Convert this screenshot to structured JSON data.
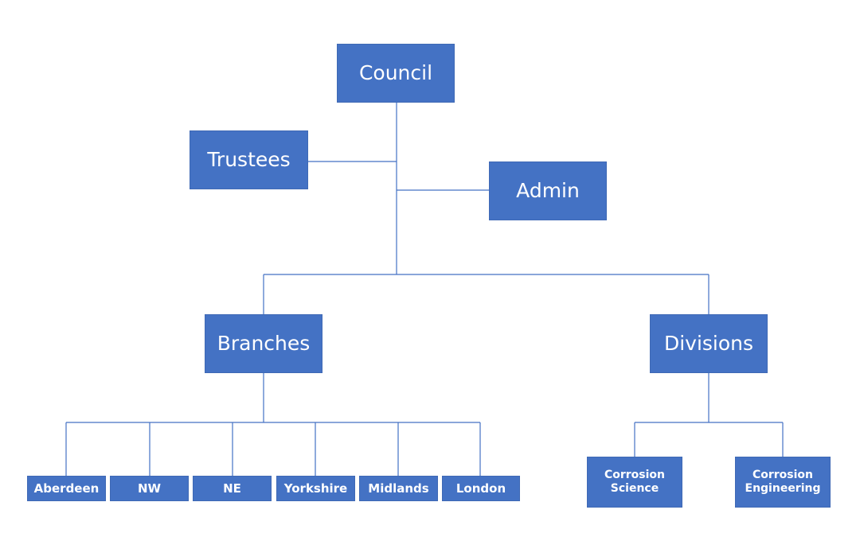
{
  "diagram": {
    "type": "org-chart",
    "colors": {
      "node_fill": "#4472c4",
      "node_text": "#ffffff",
      "connector": "#4472c4",
      "background": "#ffffff"
    },
    "nodes": {
      "council": {
        "label": "Council"
      },
      "trustees": {
        "label": "Trustees"
      },
      "admin": {
        "label": "Admin"
      },
      "branches": {
        "label": "Branches"
      },
      "divisions": {
        "label": "Divisions"
      },
      "aberdeen": {
        "label": "Aberdeen"
      },
      "nw": {
        "label": "NW"
      },
      "ne": {
        "label": "NE"
      },
      "yorkshire": {
        "label": "Yorkshire"
      },
      "midlands": {
        "label": "Midlands"
      },
      "london": {
        "label": "London"
      },
      "corrosion_science": {
        "label_line1": "Corrosion",
        "label_line2": "Science"
      },
      "corrosion_engineering": {
        "label_line1": "Corrosion",
        "label_line2": "Engineering"
      }
    },
    "edges": [
      [
        "council",
        "trustees"
      ],
      [
        "council",
        "admin"
      ],
      [
        "council",
        "branches"
      ],
      [
        "council",
        "divisions"
      ],
      [
        "branches",
        "aberdeen"
      ],
      [
        "branches",
        "nw"
      ],
      [
        "branches",
        "ne"
      ],
      [
        "branches",
        "yorkshire"
      ],
      [
        "branches",
        "midlands"
      ],
      [
        "branches",
        "london"
      ],
      [
        "divisions",
        "corrosion_science"
      ],
      [
        "divisions",
        "corrosion_engineering"
      ]
    ]
  }
}
